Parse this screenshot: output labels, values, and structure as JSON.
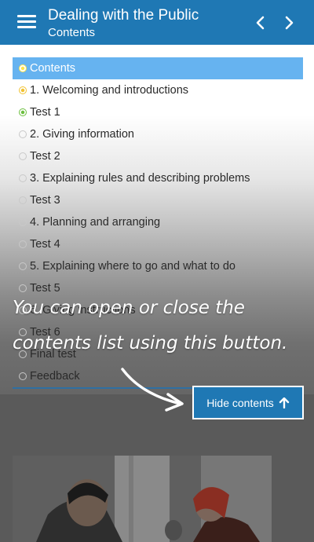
{
  "header": {
    "title": "Dealing with the Public",
    "subtitle": "Contents",
    "icons": {
      "menu": "hamburger-icon",
      "prev": "chevron-left-icon",
      "next": "chevron-right-icon"
    }
  },
  "toc": {
    "items": [
      {
        "label": "Contents",
        "status": "current"
      },
      {
        "label": "1. Welcoming and introductions",
        "status": "in-progress"
      },
      {
        "label": "Test 1",
        "status": "complete"
      },
      {
        "label": "2. Giving information",
        "status": "not-started"
      },
      {
        "label": "Test 2",
        "status": "not-started"
      },
      {
        "label": "3. Explaining rules and describing problems",
        "status": "not-started"
      },
      {
        "label": "Test 3",
        "status": "not-started"
      },
      {
        "label": "4. Planning and arranging",
        "status": "not-started"
      },
      {
        "label": "Test 4",
        "status": "not-started"
      },
      {
        "label": "5. Explaining where to go and what to do",
        "status": "not-started"
      },
      {
        "label": "Test 5",
        "status": "not-started"
      },
      {
        "label": "6. Giving instructions",
        "status": "not-started"
      },
      {
        "label": "Test 6",
        "status": "not-started"
      },
      {
        "label": "Final test",
        "status": "not-started"
      },
      {
        "label": "Feedback",
        "status": "not-started"
      }
    ]
  },
  "hide_button": {
    "label": "Hide contents",
    "icon": "arrow-up-icon"
  },
  "tooltip": {
    "line1": "You can open or close the",
    "line2": "contents list using this button."
  },
  "colors": {
    "header": "#1f78b4",
    "active_item": "#66b3f0",
    "in_progress": "#f1c232",
    "complete": "#6cbf3f"
  }
}
